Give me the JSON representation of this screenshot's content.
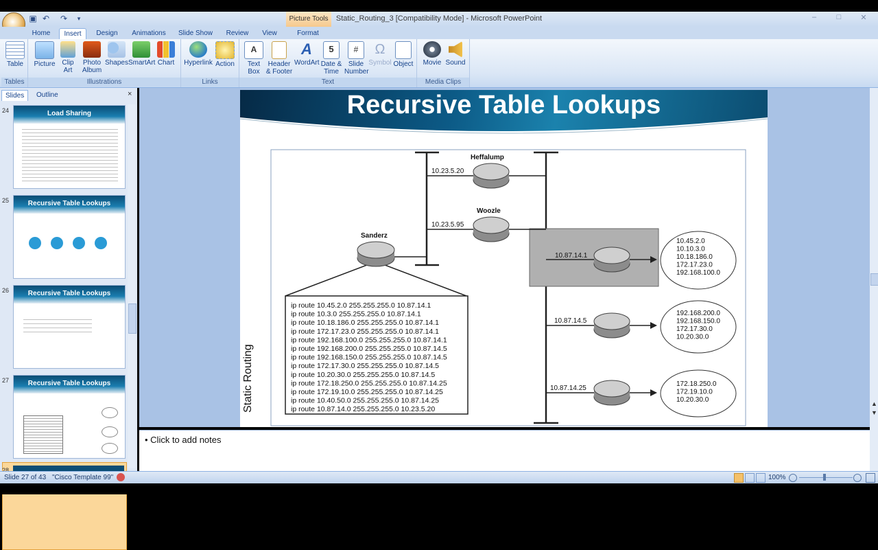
{
  "window": {
    "title": "Static_Routing_3 [Compatibility Mode] - Microsoft PowerPoint",
    "contextual_tab": "Picture Tools",
    "controls": [
      "–",
      "□",
      "✕"
    ]
  },
  "tabs": [
    "Home",
    "Insert",
    "Design",
    "Animations",
    "Slide Show",
    "Review",
    "View",
    "Format"
  ],
  "active_tab": "Insert",
  "ribbon": {
    "groups": {
      "tables": "Tables",
      "illustrations": "Illustrations",
      "links": "Links",
      "text": "Text",
      "media": "Media Clips"
    },
    "buttons": {
      "table": "Table",
      "picture": "Picture",
      "clip_art": "Clip Art",
      "photo_album": "Photo Album",
      "shapes": "Shapes",
      "smartart": "SmartArt",
      "chart": "Chart",
      "hyperlink": "Hyperlink",
      "action": "Action",
      "text_box": "Text Box",
      "header_footer": "Header & Footer",
      "wordart": "WordArt",
      "date_time": "Date & Time",
      "slide_number": "Slide Number",
      "symbol": "Symbol",
      "object": "Object",
      "movie": "Movie",
      "sound": "Sound"
    }
  },
  "panel": {
    "tab_slides": "Slides",
    "tab_outline": "Outline",
    "close": "×",
    "thumbnails": [
      {
        "num": "24",
        "title": "Load Sharing"
      },
      {
        "num": "25",
        "title": "Recursive Table Lookups"
      },
      {
        "num": "26",
        "title": "Recursive Table Lookups"
      },
      {
        "num": "27",
        "title": "Recursive Table Lookups"
      },
      {
        "num": "28",
        "title": ""
      }
    ]
  },
  "slide": {
    "title": "Recursive Table Lookups",
    "side_text": "Static Routing",
    "routers": {
      "heffalump": "Heffalump",
      "woozle": "Woozle",
      "sanderz": "Sanderz"
    },
    "link_labels": {
      "heffalump": "10.23.5.20",
      "woozle": "10.23.5.95",
      "r1": "10.87.14.1",
      "r2": "10.87.14.5",
      "r3": "10.87.14.25"
    },
    "routes": [
      "ip route 10.45.2.0 255.255.255.0 10.87.14.1",
      "ip route 10.3.0 255.255.255.0 10.87.14.1",
      "ip route 10.18.186.0 255.255.255.0 10.87.14.1",
      "ip route 172.17.23.0 255.255.255.0 10.87.14.1",
      "ip route 192.168.100.0 255.255.255.0 10.87.14.1",
      "ip route 192.168.200.0 255.255.255.0 10.87.14.5",
      "ip route 192.168.150.0 255.255.255.0 10.87.14.5",
      "ip route 172.17.30.0 255.255.255.0 10.87.14.5",
      "ip route 10.20.30.0 255.255.255.0 10.87.14.5",
      "ip route 172.18.250.0 255.255.255.0 10.87.14.25",
      "ip route 172.19.10.0 255.255.255.0 10.87.14.25",
      "ip route 10.40.50.0 255.255.255.0 10.87.14.25",
      "ip route 10.87.14.0 255.255.255.0 10.23.5.20"
    ],
    "clouds": [
      [
        "10.45.2.0",
        "10.10.3.0",
        "10.18.186.0",
        "172.17.23.0",
        "192.168.100.0"
      ],
      [
        "192.168.200.0",
        "192.168.150.0",
        "172.17.30.0",
        "10.20.30.0"
      ],
      [
        "172.18.250.0",
        "172.19.10.0",
        "10.20.30.0"
      ]
    ]
  },
  "notes": "• Click to add notes",
  "status": {
    "slide": "Slide 27 of 43",
    "template": "\"Cisco Template 99\"",
    "zoom": "100%"
  }
}
